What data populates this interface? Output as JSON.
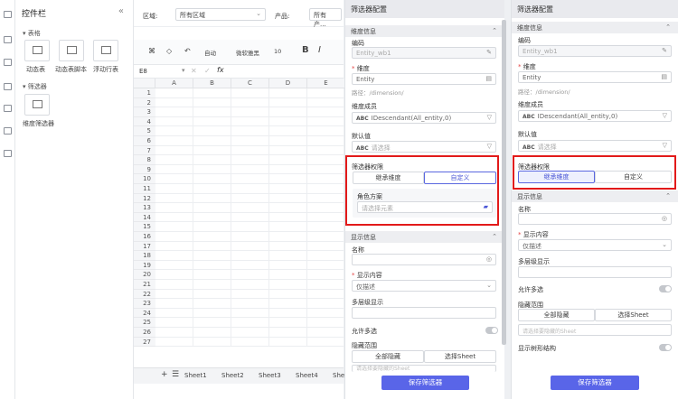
{
  "nav": {
    "icons": [
      "layout-icon",
      "grid-icon",
      "table-icon",
      "chart-icon",
      "box-icon",
      "data-icon",
      "tree-icon"
    ]
  },
  "widgets": {
    "title": "控件栏",
    "collapse": "«",
    "group_table": "表格",
    "items_table": [
      "动态表",
      "动态表脚本",
      "浮动行表"
    ],
    "group_filter": "筛选器",
    "items_filter": [
      "维度筛选器"
    ]
  },
  "sheet": {
    "topbar": {
      "region_label": "区域:",
      "region_value": "所有区域",
      "product_label": "产品:",
      "product_value": "所有产..."
    },
    "toolbar": {
      "font": "微软雅黑",
      "size": "10",
      "auto": "自动"
    },
    "cell_ref": "E8",
    "fx": "fx",
    "columns": [
      "A",
      "B",
      "C",
      "D",
      "E"
    ],
    "rows": [
      "1",
      "2",
      "3",
      "4",
      "5",
      "6",
      "7",
      "8",
      "9",
      "10",
      "11",
      "12",
      "13",
      "14",
      "15",
      "16",
      "17",
      "18",
      "19",
      "20",
      "21",
      "22",
      "23",
      "24",
      "25",
      "26",
      "27"
    ],
    "tabs": [
      "Sheet1",
      "Sheet2",
      "Sheet3",
      "Sheet4",
      "She"
    ]
  },
  "panel1": {
    "title": "筛选器配置",
    "sec_dim": "维度信息",
    "code_label": "编码",
    "code_value": "Entity_wb1",
    "dim_label": "维度",
    "dim_value": "Entity",
    "path": "路径：/dimension/",
    "member_label": "维度成员",
    "member_value": "IDescendant(All_entity,0)",
    "default_label": "默认值",
    "default_placeholder": "请选择",
    "perm_label": "筛选器权限",
    "perm_opt1": "继承维度",
    "perm_opt2": "自定义",
    "role_label": "角色方案",
    "role_placeholder": "请选择元素",
    "sec_show": "显示信息",
    "name_label": "名称",
    "content_label": "显示内容",
    "content_value": "仅描述",
    "multi_label": "多层级显示",
    "allow_multi": "允许多选",
    "hide_label": "隐藏范围",
    "hide_opt1": "全部隐藏",
    "hide_opt2": "选择Sheet",
    "hide_placeholder": "请选择要隐藏的Sheet",
    "save": "保存筛选器"
  },
  "panel2": {
    "title": "筛选器配置",
    "sec_dim": "维度信息",
    "code_label": "编码",
    "code_value": "Entity_wb1",
    "dim_label": "维度",
    "dim_value": "Entity",
    "path": "路径：/dimension/",
    "member_label": "维度成员",
    "member_value": "IDescendant(All_entity,0)",
    "default_label": "默认值",
    "default_placeholder": "请选择",
    "perm_label": "筛选器权限",
    "perm_opt1": "继承维度",
    "perm_opt2": "自定义",
    "sec_show": "显示信息",
    "name_label": "名称",
    "content_label": "显示内容",
    "content_value": "仅描述",
    "multi_label": "多层级显示",
    "allow_multi": "允许多选",
    "hide_label": "隐藏范围",
    "hide_opt1": "全部隐藏",
    "hide_opt2": "选择Sheet",
    "hide_placeholder": "请选择要隐藏的Sheet",
    "tree_label": "显示树形结构",
    "save": "保存筛选器"
  }
}
